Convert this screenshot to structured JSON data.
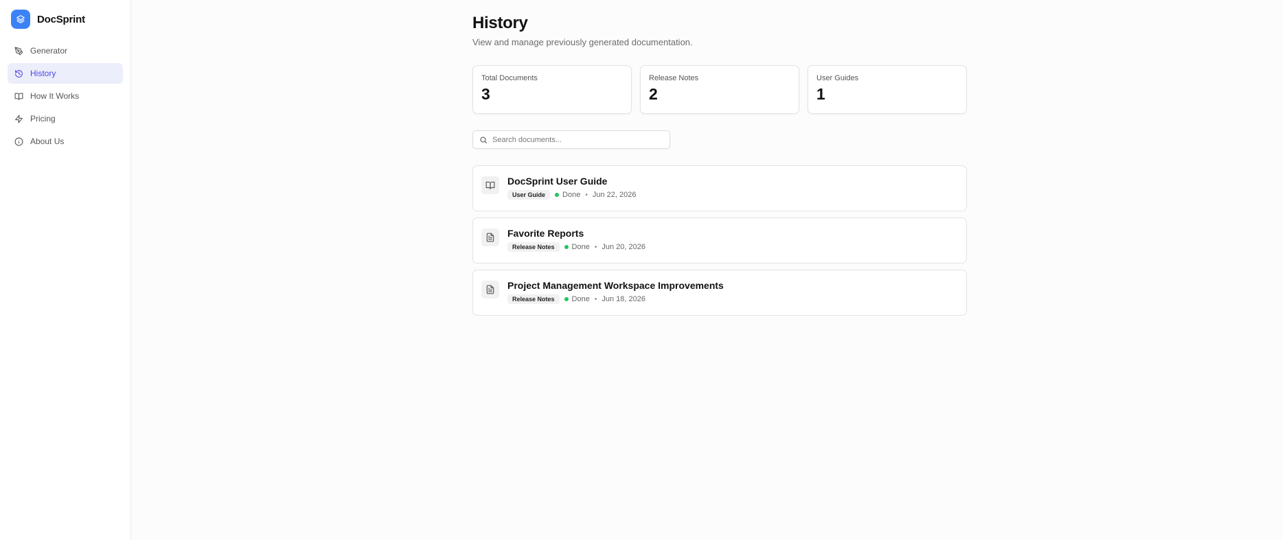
{
  "app": {
    "name": "DocSprint",
    "accent": "#3b82f6",
    "active_color": "#4f46e5"
  },
  "sidebar": {
    "items": [
      {
        "label": "Generator",
        "icon": "pen-tool-icon"
      },
      {
        "label": "History",
        "icon": "history-icon",
        "active": true
      },
      {
        "label": "How It Works",
        "icon": "book-open-icon"
      },
      {
        "label": "Pricing",
        "icon": "zap-icon"
      },
      {
        "label": "About Us",
        "icon": "info-icon"
      }
    ]
  },
  "page": {
    "title": "History",
    "subtitle": "View and manage previously generated documentation."
  },
  "stats": [
    {
      "label": "Total Documents",
      "value": "3"
    },
    {
      "label": "Release Notes",
      "value": "2"
    },
    {
      "label": "User Guides",
      "value": "1"
    }
  ],
  "search": {
    "placeholder": "Search documents..."
  },
  "documents": [
    {
      "title": "DocSprint User Guide",
      "tag": "User Guide",
      "status": "Done",
      "date": "Jun 22, 2026",
      "icon": "book-open-icon"
    },
    {
      "title": "Favorite Reports",
      "tag": "Release Notes",
      "status": "Done",
      "date": "Jun 20, 2026",
      "icon": "file-text-icon"
    },
    {
      "title": "Project Management Workspace Improvements",
      "tag": "Release Notes",
      "status": "Done",
      "date": "Jun 18, 2026",
      "icon": "file-text-icon"
    }
  ],
  "status_color": "#22c55e"
}
